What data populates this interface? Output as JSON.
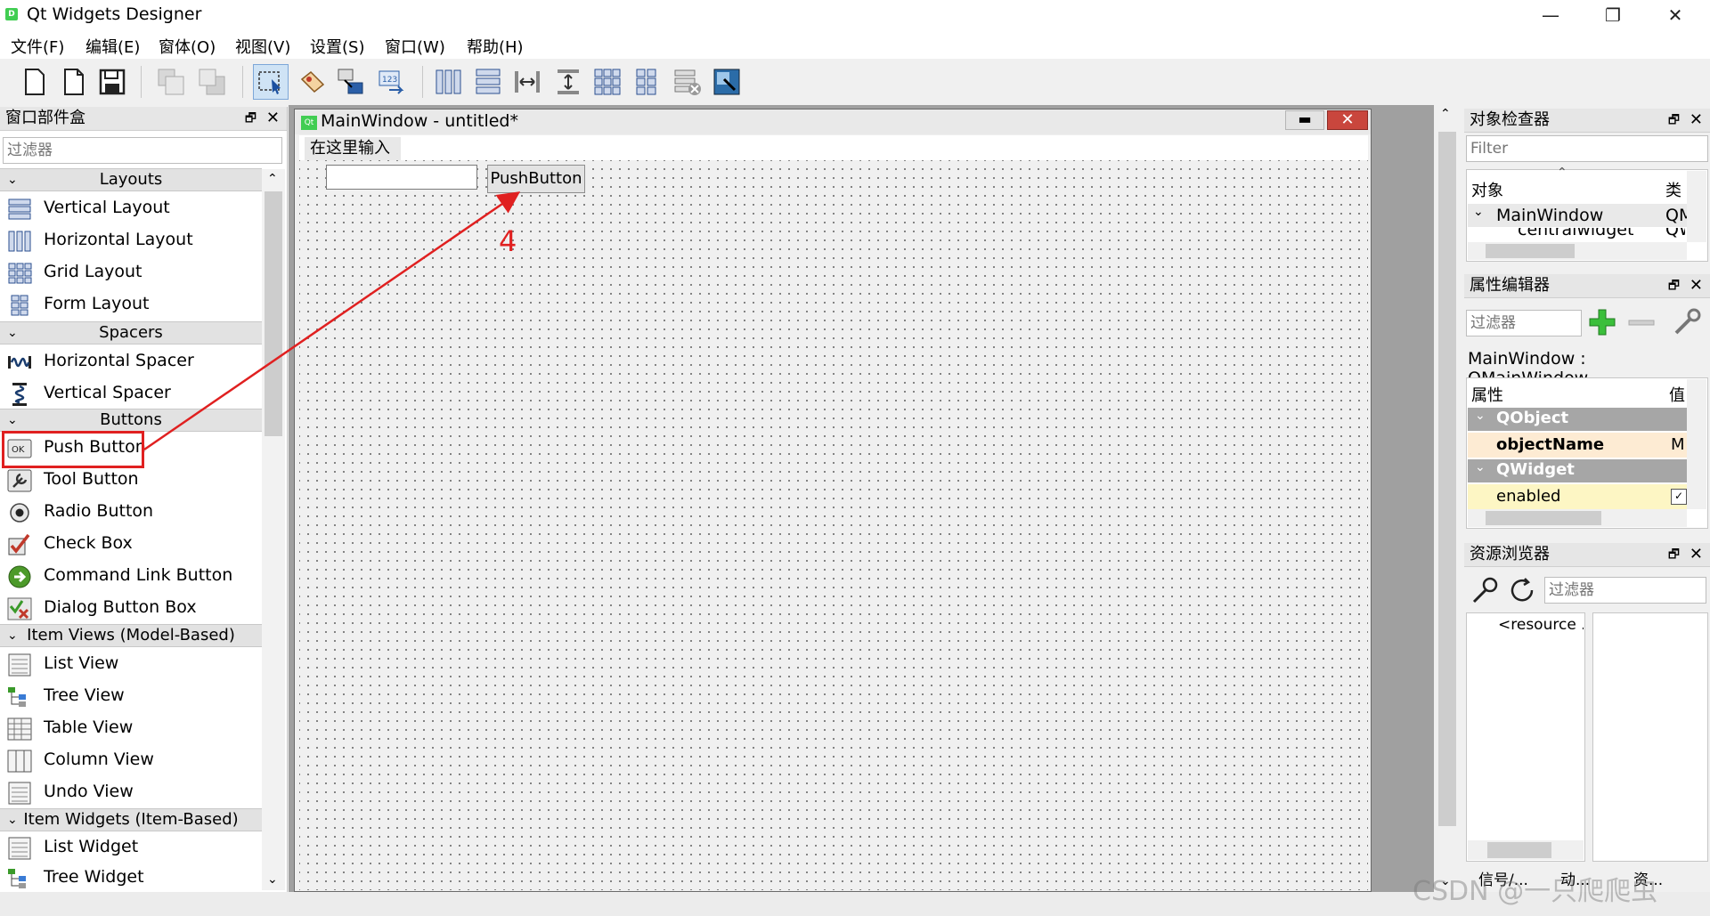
{
  "window": {
    "title": "Qt Widgets Designer",
    "app_icon_letter": "D",
    "minimize_glyph": "—",
    "maximize_glyph": "❐",
    "close_glyph": "✕"
  },
  "menu": [
    "文件(F)",
    "编辑(E)",
    "窗体(O)",
    "视图(V)",
    "设置(S)",
    "窗口(W)",
    "帮助(H)"
  ],
  "toolbar_icons": [
    "new-form-icon",
    "open-form-icon",
    "save-form-icon",
    "send-to-back-icon",
    "bring-to-front-icon",
    "edit-widgets-icon",
    "edit-signals-slots-icon",
    "edit-buddies-icon",
    "edit-tab-order-icon",
    "layout-horizontal-icon",
    "layout-vertical-icon",
    "layout-h-splitter-icon",
    "layout-v-splitter-icon",
    "layout-grid-icon",
    "layout-form-icon",
    "break-layout-icon",
    "adjust-size-icon"
  ],
  "widget_box": {
    "title": "窗口部件盒",
    "filter_placeholder": "过滤器",
    "float_glyph": "🗗",
    "close_glyph": "✕",
    "categories": {
      "layouts": "Layouts",
      "spacers": "Spacers",
      "buttons": "Buttons",
      "item_views": "Item Views (Model-Based)",
      "item_widgets": "Item Widgets (Item-Based)"
    },
    "items": {
      "vertical_layout": "Vertical Layout",
      "horizontal_layout": "Horizontal Layout",
      "grid_layout": "Grid Layout",
      "form_layout": "Form Layout",
      "horizontal_spacer": "Horizontal Spacer",
      "vertical_spacer": "Vertical Spacer",
      "push_button": "Push Button",
      "tool_button": "Tool Button",
      "radio_button": "Radio Button",
      "check_box": "Check Box",
      "command_link_button": "Command Link Button",
      "dialog_button_box": "Dialog Button Box",
      "list_view": "List View",
      "tree_view": "Tree View",
      "table_view": "Table View",
      "column_view": "Column View",
      "undo_view": "Undo View",
      "list_widget": "List Widget",
      "tree_widget": "Tree Widget"
    }
  },
  "form_window": {
    "title": "MainWindow - untitled*",
    "qt_badge": "Qt",
    "menu_placeholder": "在这里输入",
    "push_button_label": "PushButton",
    "min_glyph": "▬",
    "close_glyph": "✕"
  },
  "annotation": {
    "number": "4",
    "color": "#e02020"
  },
  "object_inspector": {
    "title": "对象检查器",
    "filter_placeholder": "Filter",
    "col_object": "对象",
    "col_class": "类",
    "row1_name": "MainWindow",
    "row1_class": "QM",
    "row2_name": "centralwidget",
    "row2_class": "QW"
  },
  "property_editor": {
    "title": "属性编辑器",
    "filter_placeholder": "过滤器",
    "context": "MainWindow : QMainWindow",
    "col_property": "属性",
    "col_value": "值",
    "group_qobject": "QObject",
    "prop_object_name": "objectName",
    "prop_object_name_value": "M",
    "group_qwidget": "QWidget",
    "prop_enabled": "enabled"
  },
  "resource_browser": {
    "title": "资源浏览器",
    "filter_placeholder": "过滤器",
    "root": "<resource ."
  },
  "bottom_tabs": [
    "信号/...",
    "动...",
    "资..."
  ],
  "watermark": "CSDN @一只爬爬虫"
}
